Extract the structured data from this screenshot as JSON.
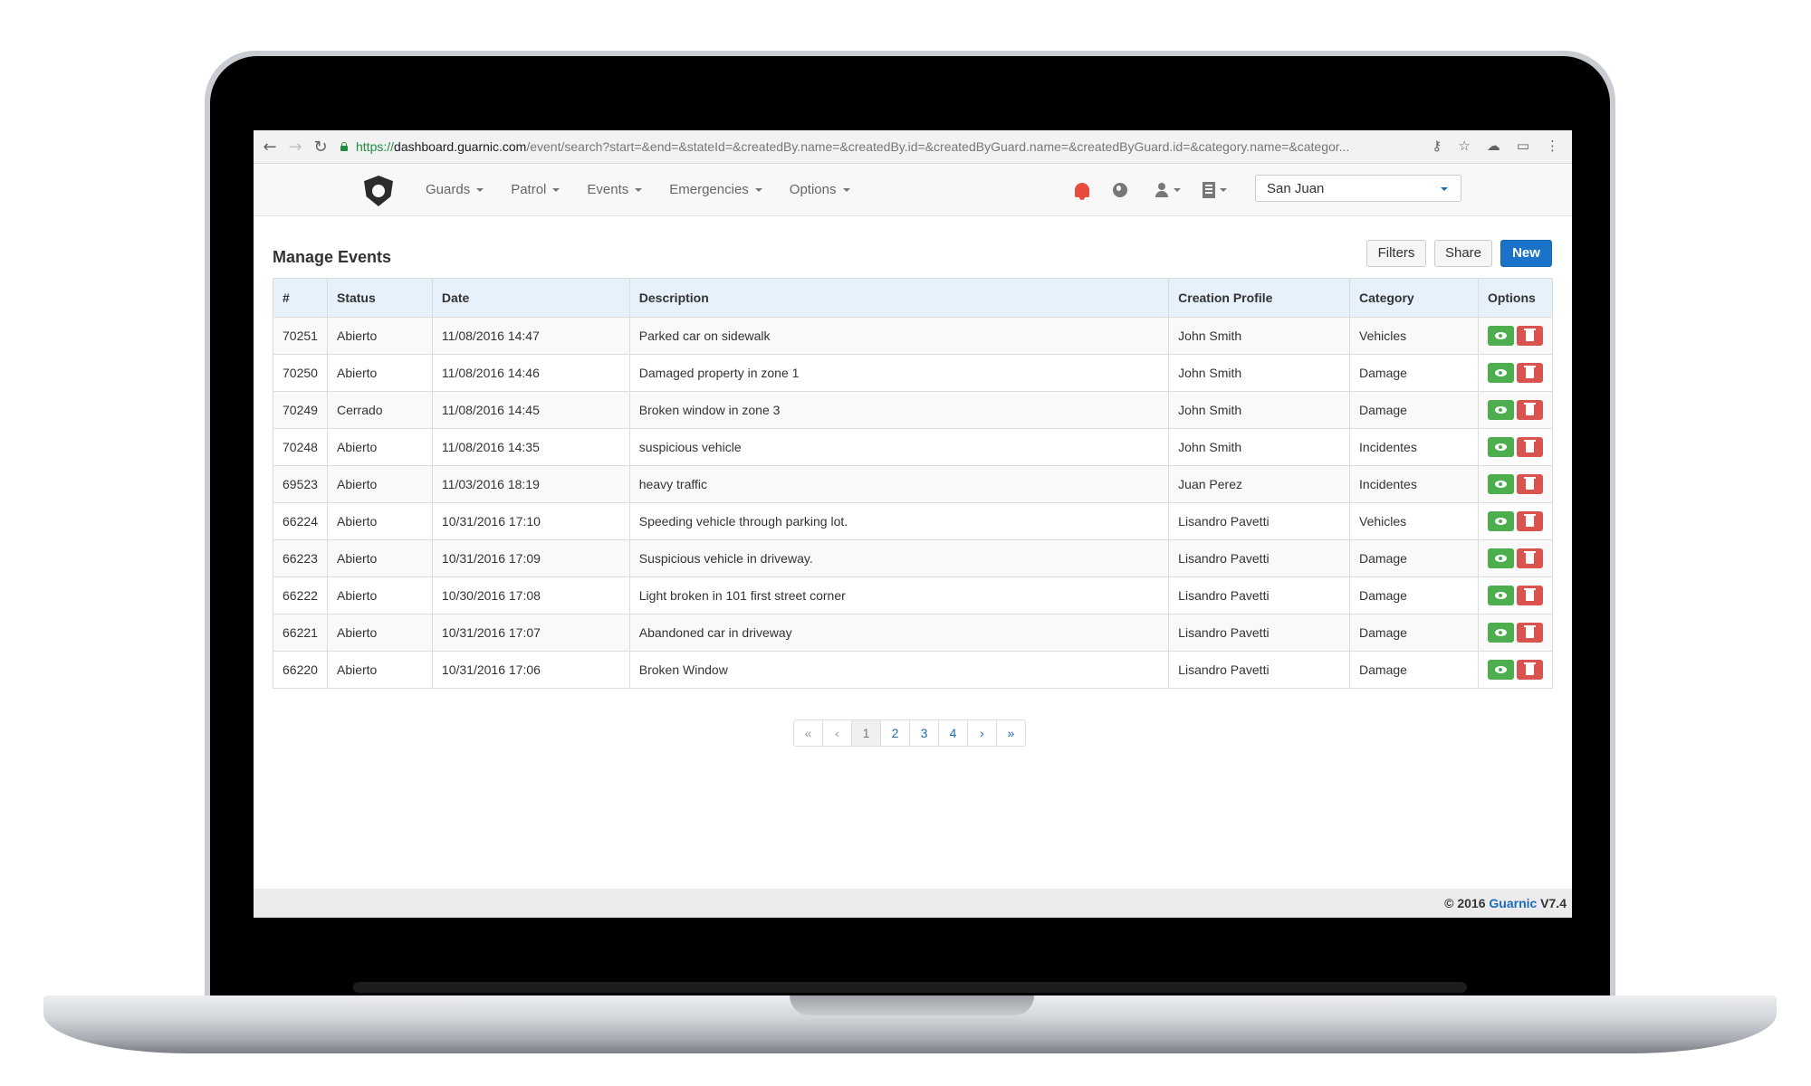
{
  "browser": {
    "url_scheme": "https://",
    "url_host": "dashboard.guarnic.com",
    "url_path": "/event/search?start=&end=&stateId=&createdBy.name=&createdBy.id=&createdByGuard.name=&createdByGuard.id=&category.name=&categor..."
  },
  "nav": {
    "menu": [
      {
        "label": "Guards"
      },
      {
        "label": "Patrol"
      },
      {
        "label": "Events"
      },
      {
        "label": "Emergencies"
      },
      {
        "label": "Options"
      }
    ],
    "site_selected": "San Juan",
    "alert_color": "#e74c3c"
  },
  "page": {
    "title": "Manage Events",
    "buttons": {
      "filters": "Filters",
      "share": "Share",
      "new": "New"
    }
  },
  "table": {
    "headers": [
      "#",
      "Status",
      "Date",
      "Description",
      "Creation Profile",
      "Category",
      "Options"
    ],
    "rows": [
      {
        "id": "70251",
        "status": "Abierto",
        "date": "11/08/2016 14:47",
        "description": "Parked car on sidewalk",
        "profile": "John Smith",
        "category": "Vehicles"
      },
      {
        "id": "70250",
        "status": "Abierto",
        "date": "11/08/2016 14:46",
        "description": "Damaged property in zone 1",
        "profile": "John Smith",
        "category": "Damage"
      },
      {
        "id": "70249",
        "status": "Cerrado",
        "date": "11/08/2016 14:45",
        "description": "Broken window in zone 3",
        "profile": "John Smith",
        "category": "Damage"
      },
      {
        "id": "70248",
        "status": "Abierto",
        "date": "11/08/2016 14:35",
        "description": "suspicious vehicle",
        "profile": "John Smith",
        "category": "Incidentes"
      },
      {
        "id": "69523",
        "status": "Abierto",
        "date": "11/03/2016 18:19",
        "description": "heavy traffic",
        "profile": "Juan Perez",
        "category": "Incidentes"
      },
      {
        "id": "66224",
        "status": "Abierto",
        "date": "10/31/2016 17:10",
        "description": "Speeding vehicle through parking lot.",
        "profile": "Lisandro Pavetti",
        "category": "Vehicles"
      },
      {
        "id": "66223",
        "status": "Abierto",
        "date": "10/31/2016 17:09",
        "description": "Suspicious vehicle in driveway.",
        "profile": "Lisandro Pavetti",
        "category": "Damage"
      },
      {
        "id": "66222",
        "status": "Abierto",
        "date": "10/30/2016 17:08",
        "description": "Light broken in 101 first street corner",
        "profile": "Lisandro Pavetti",
        "category": "Damage"
      },
      {
        "id": "66221",
        "status": "Abierto",
        "date": "10/31/2016 17:07",
        "description": "Abandoned car in driveway",
        "profile": "Lisandro Pavetti",
        "category": "Damage"
      },
      {
        "id": "66220",
        "status": "Abierto",
        "date": "10/31/2016 17:06",
        "description": "Broken Window",
        "profile": "Lisandro Pavetti",
        "category": "Damage"
      }
    ],
    "option_colors": {
      "view": "#4cae4c",
      "delete": "#d9534f"
    }
  },
  "pagination": {
    "first": "«",
    "prev": "‹",
    "pages": [
      "1",
      "2",
      "3",
      "4"
    ],
    "current": "1",
    "next": "›",
    "last": "»"
  },
  "footer": {
    "prefix": "© 2016 ",
    "brand": "Guarnic",
    "version": " V7.4"
  }
}
